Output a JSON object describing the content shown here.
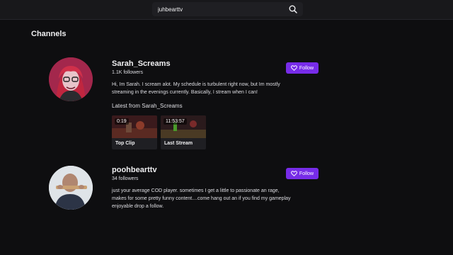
{
  "search": {
    "value": "juhbearttv",
    "icon": "search-icon"
  },
  "section_title": "Channels",
  "channels": [
    {
      "name": "Sarah_Screams",
      "followers": "1.1K followers",
      "bio": "Hi, Im Sarah. I scream alot. My schedule is turbulent right now, but Im mostly streaming in the evenings currently. Basically, I stream when I can!",
      "follow_label": "Follow",
      "latest_title": "Latest from Sarah_Screams",
      "cards": [
        {
          "duration": "0:19",
          "label": "Top Clip"
        },
        {
          "duration": "11:53:57",
          "label": "Last Stream"
        }
      ]
    },
    {
      "name": "poohbearttv",
      "followers": "34 followers",
      "bio": "just your average COD player. sometimes I get a little to passionate an rage, makes for some pretty funny content....come hang out an if you find my gameplay enjoyable drop a follow.",
      "follow_label": "Follow"
    }
  ],
  "colors": {
    "background": "#0e0e10",
    "topbar": "#18181b",
    "accent": "#772ce8",
    "text": "#efeff1"
  }
}
